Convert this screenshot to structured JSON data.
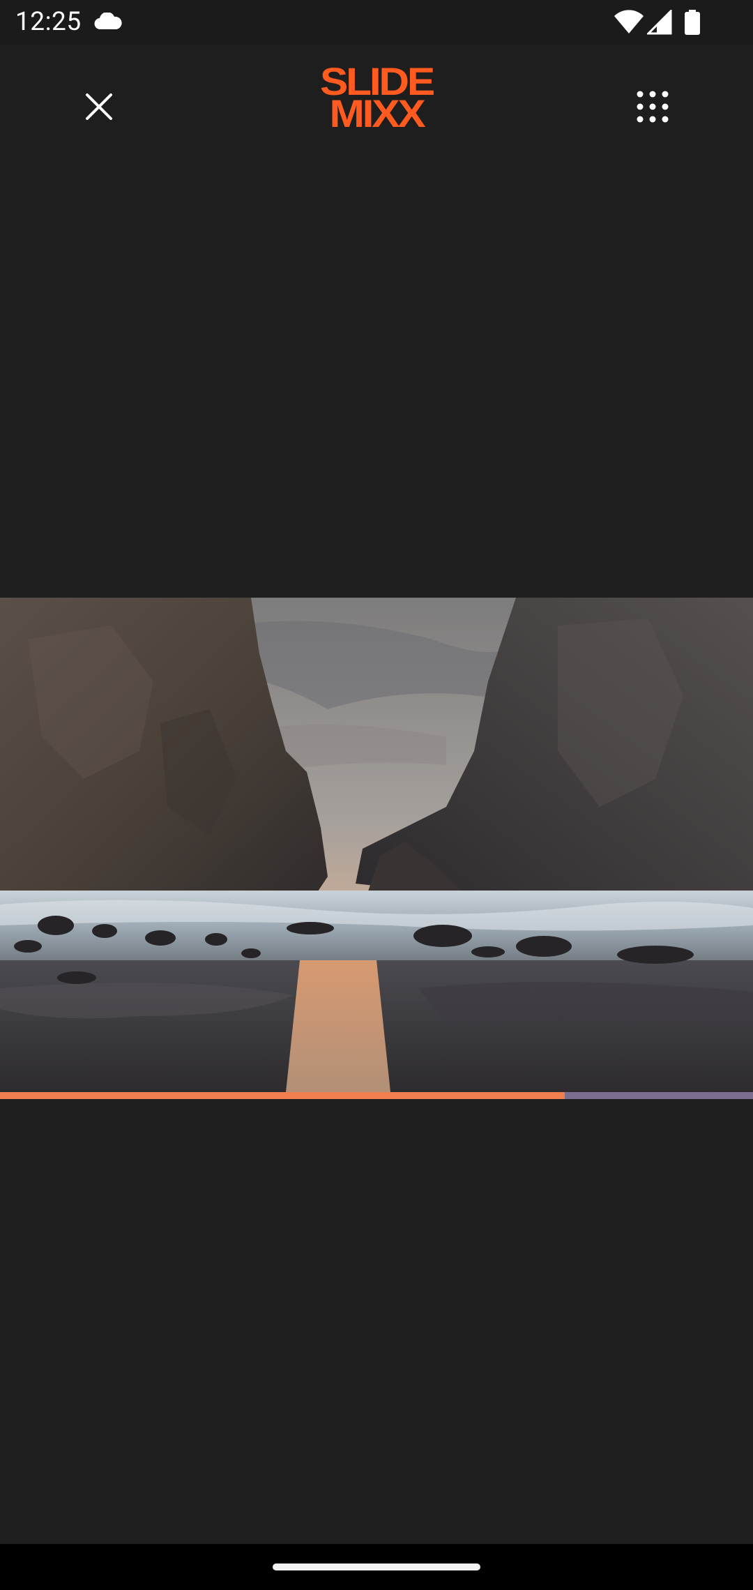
{
  "status_bar": {
    "time": "12:25",
    "icons": [
      "cloud-icon",
      "wifi-icon",
      "signal-icon",
      "battery-icon"
    ]
  },
  "app_bar": {
    "close_icon": "close-icon",
    "logo_line1": "SLIDE",
    "logo_line2": "MIXX",
    "menu_icon": "grid-menu-icon"
  },
  "player": {
    "media": "coastal sea stacks at sunset, long exposure",
    "progress": 0.75
  },
  "colors": {
    "background": "#1e1e1e",
    "brand_orange": "#ff5a1f",
    "progress_played": "#f07f4f",
    "progress_remaining": "#7b6e8e"
  }
}
